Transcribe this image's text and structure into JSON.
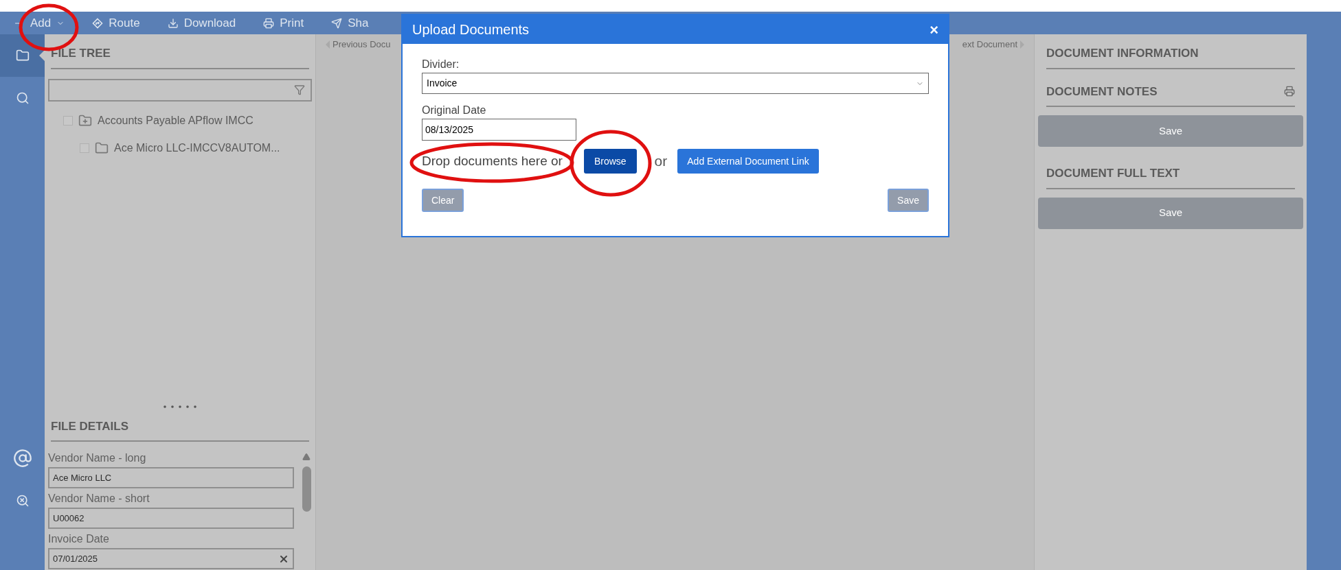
{
  "toolbar": {
    "items": [
      {
        "label": "Add",
        "kind": "add"
      },
      {
        "label": "Route",
        "kind": "route"
      },
      {
        "label": "Download",
        "kind": "download"
      },
      {
        "label": "Print",
        "kind": "print"
      },
      {
        "label": "Sha",
        "kind": "share"
      }
    ]
  },
  "sidebar": {
    "items": [
      {
        "kind": "folder",
        "selected": true
      },
      {
        "kind": "search",
        "selected": false
      },
      {
        "kind": "at",
        "selected": false
      },
      {
        "kind": "search-refresh",
        "selected": false
      }
    ]
  },
  "file_tree": {
    "title": "FILE TREE",
    "items": [
      {
        "label": "Accounts Payable APflow IMCC",
        "kind": "cabinet",
        "checked": false,
        "children": [
          {
            "label": "Ace Micro LLC-IMCCV8AUTOM...",
            "kind": "folder",
            "checked": false
          }
        ]
      }
    ]
  },
  "file_details": {
    "title": "FILE DETAILS",
    "fields": [
      {
        "label": "Vendor Name - long",
        "value": "Ace Micro LLC",
        "clearable": false
      },
      {
        "label": "Vendor Name - short",
        "value": "U00062",
        "clearable": false
      },
      {
        "label": "Invoice Date",
        "value": "07/01/2025",
        "clearable": true
      }
    ]
  },
  "viewer_nav": {
    "previous": "Previous Docu",
    "next": "ext Document"
  },
  "document_panel": {
    "sections": [
      {
        "title": "DOCUMENT INFORMATION",
        "printable": false
      },
      {
        "title": "DOCUMENT NOTES",
        "printable": true,
        "save": "Save"
      },
      {
        "title": "DOCUMENT FULL TEXT",
        "printable": false,
        "save": "Save"
      }
    ]
  },
  "dialog": {
    "title": "Upload Documents",
    "close": "×",
    "divider": {
      "label": "Divider:",
      "value": "Invoice"
    },
    "date": {
      "label": "Original Date",
      "value": "08/13/2025"
    },
    "drop_text": "Drop documents here or",
    "browse": "Browse",
    "or": "or",
    "external_link": "Add External Document Link",
    "clear": {
      "label": "Clear",
      "disabled": true
    },
    "save": {
      "label": "Save",
      "disabled": true
    }
  }
}
